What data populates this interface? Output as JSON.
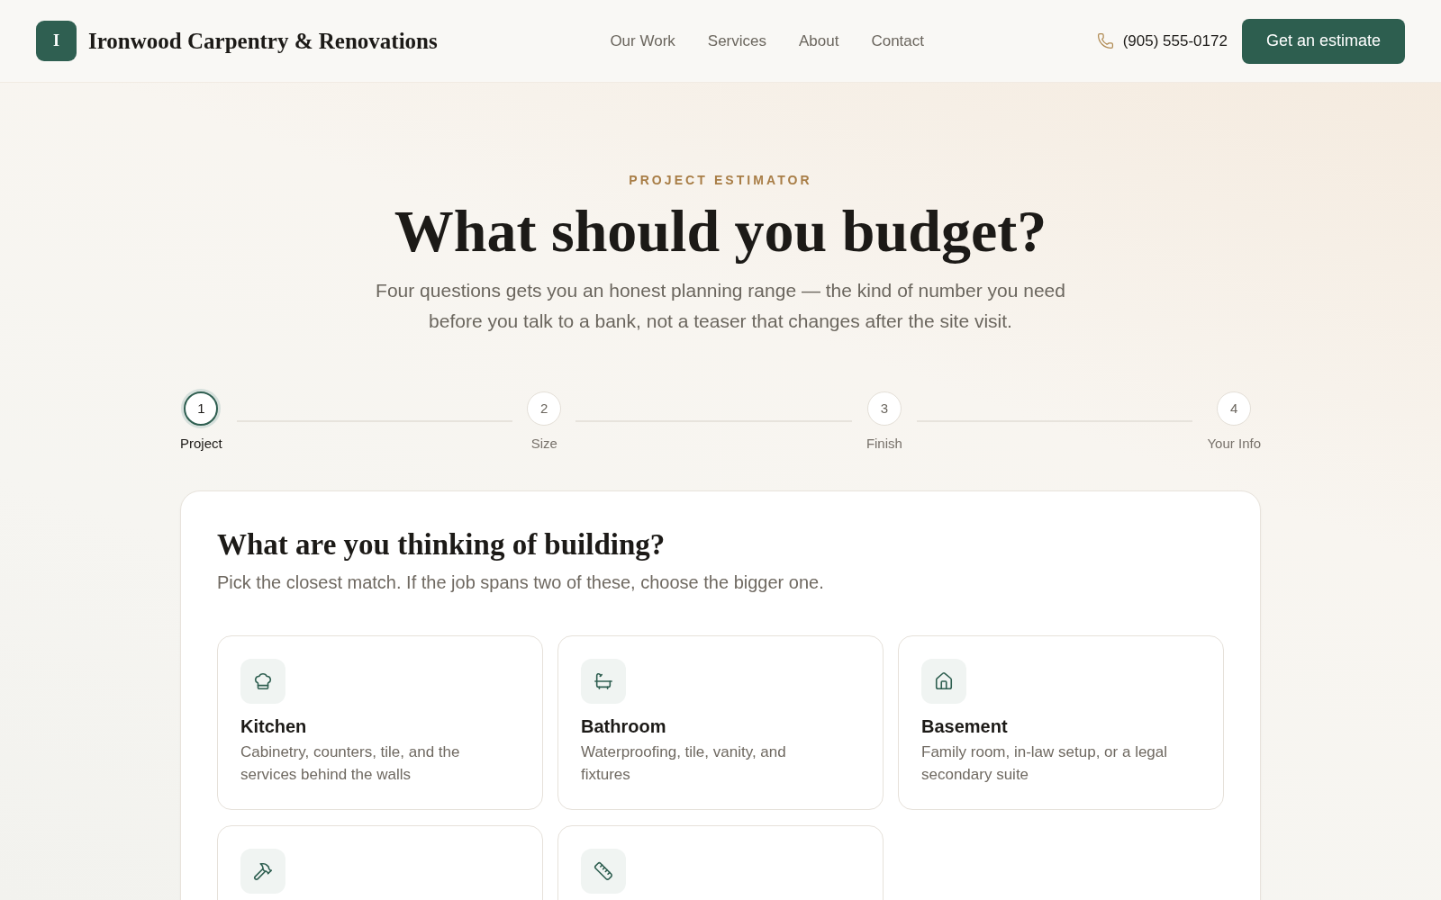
{
  "header": {
    "logo_letter": "I",
    "brand": "Ironwood Carpentry & Renovations",
    "nav": [
      "Our Work",
      "Services",
      "About",
      "Contact"
    ],
    "phone": "(905) 555-0172",
    "cta": "Get an estimate"
  },
  "hero": {
    "eyebrow": "PROJECT ESTIMATOR",
    "title": "What should you budget?",
    "subtitle": "Four questions gets you an honest planning range — the kind of number you need before you talk to a bank, not a teaser that changes after the site visit."
  },
  "steps": [
    {
      "number": "1",
      "label": "Project",
      "selected": true
    },
    {
      "number": "2",
      "label": "Size",
      "selected": false
    },
    {
      "number": "3",
      "label": "Finish",
      "selected": false
    },
    {
      "number": "4",
      "label": "Your Info",
      "selected": false
    }
  ],
  "question": {
    "title": "What are you thinking of building?",
    "hint": "Pick the closest match. If the job spans two of these, choose the bigger one.",
    "options": [
      {
        "title": "Kitchen",
        "description": "Cabinetry, counters, tile, and the services behind the walls",
        "selected": false
      },
      {
        "title": "Bathroom",
        "description": "Waterproofing, tile, vanity, and fixtures",
        "selected": false
      },
      {
        "title": "Basement",
        "description": "Family room, in-law setup, or a legal secondary suite",
        "selected": false
      },
      {
        "selected": false
      },
      {
        "selected": false
      }
    ]
  }
}
